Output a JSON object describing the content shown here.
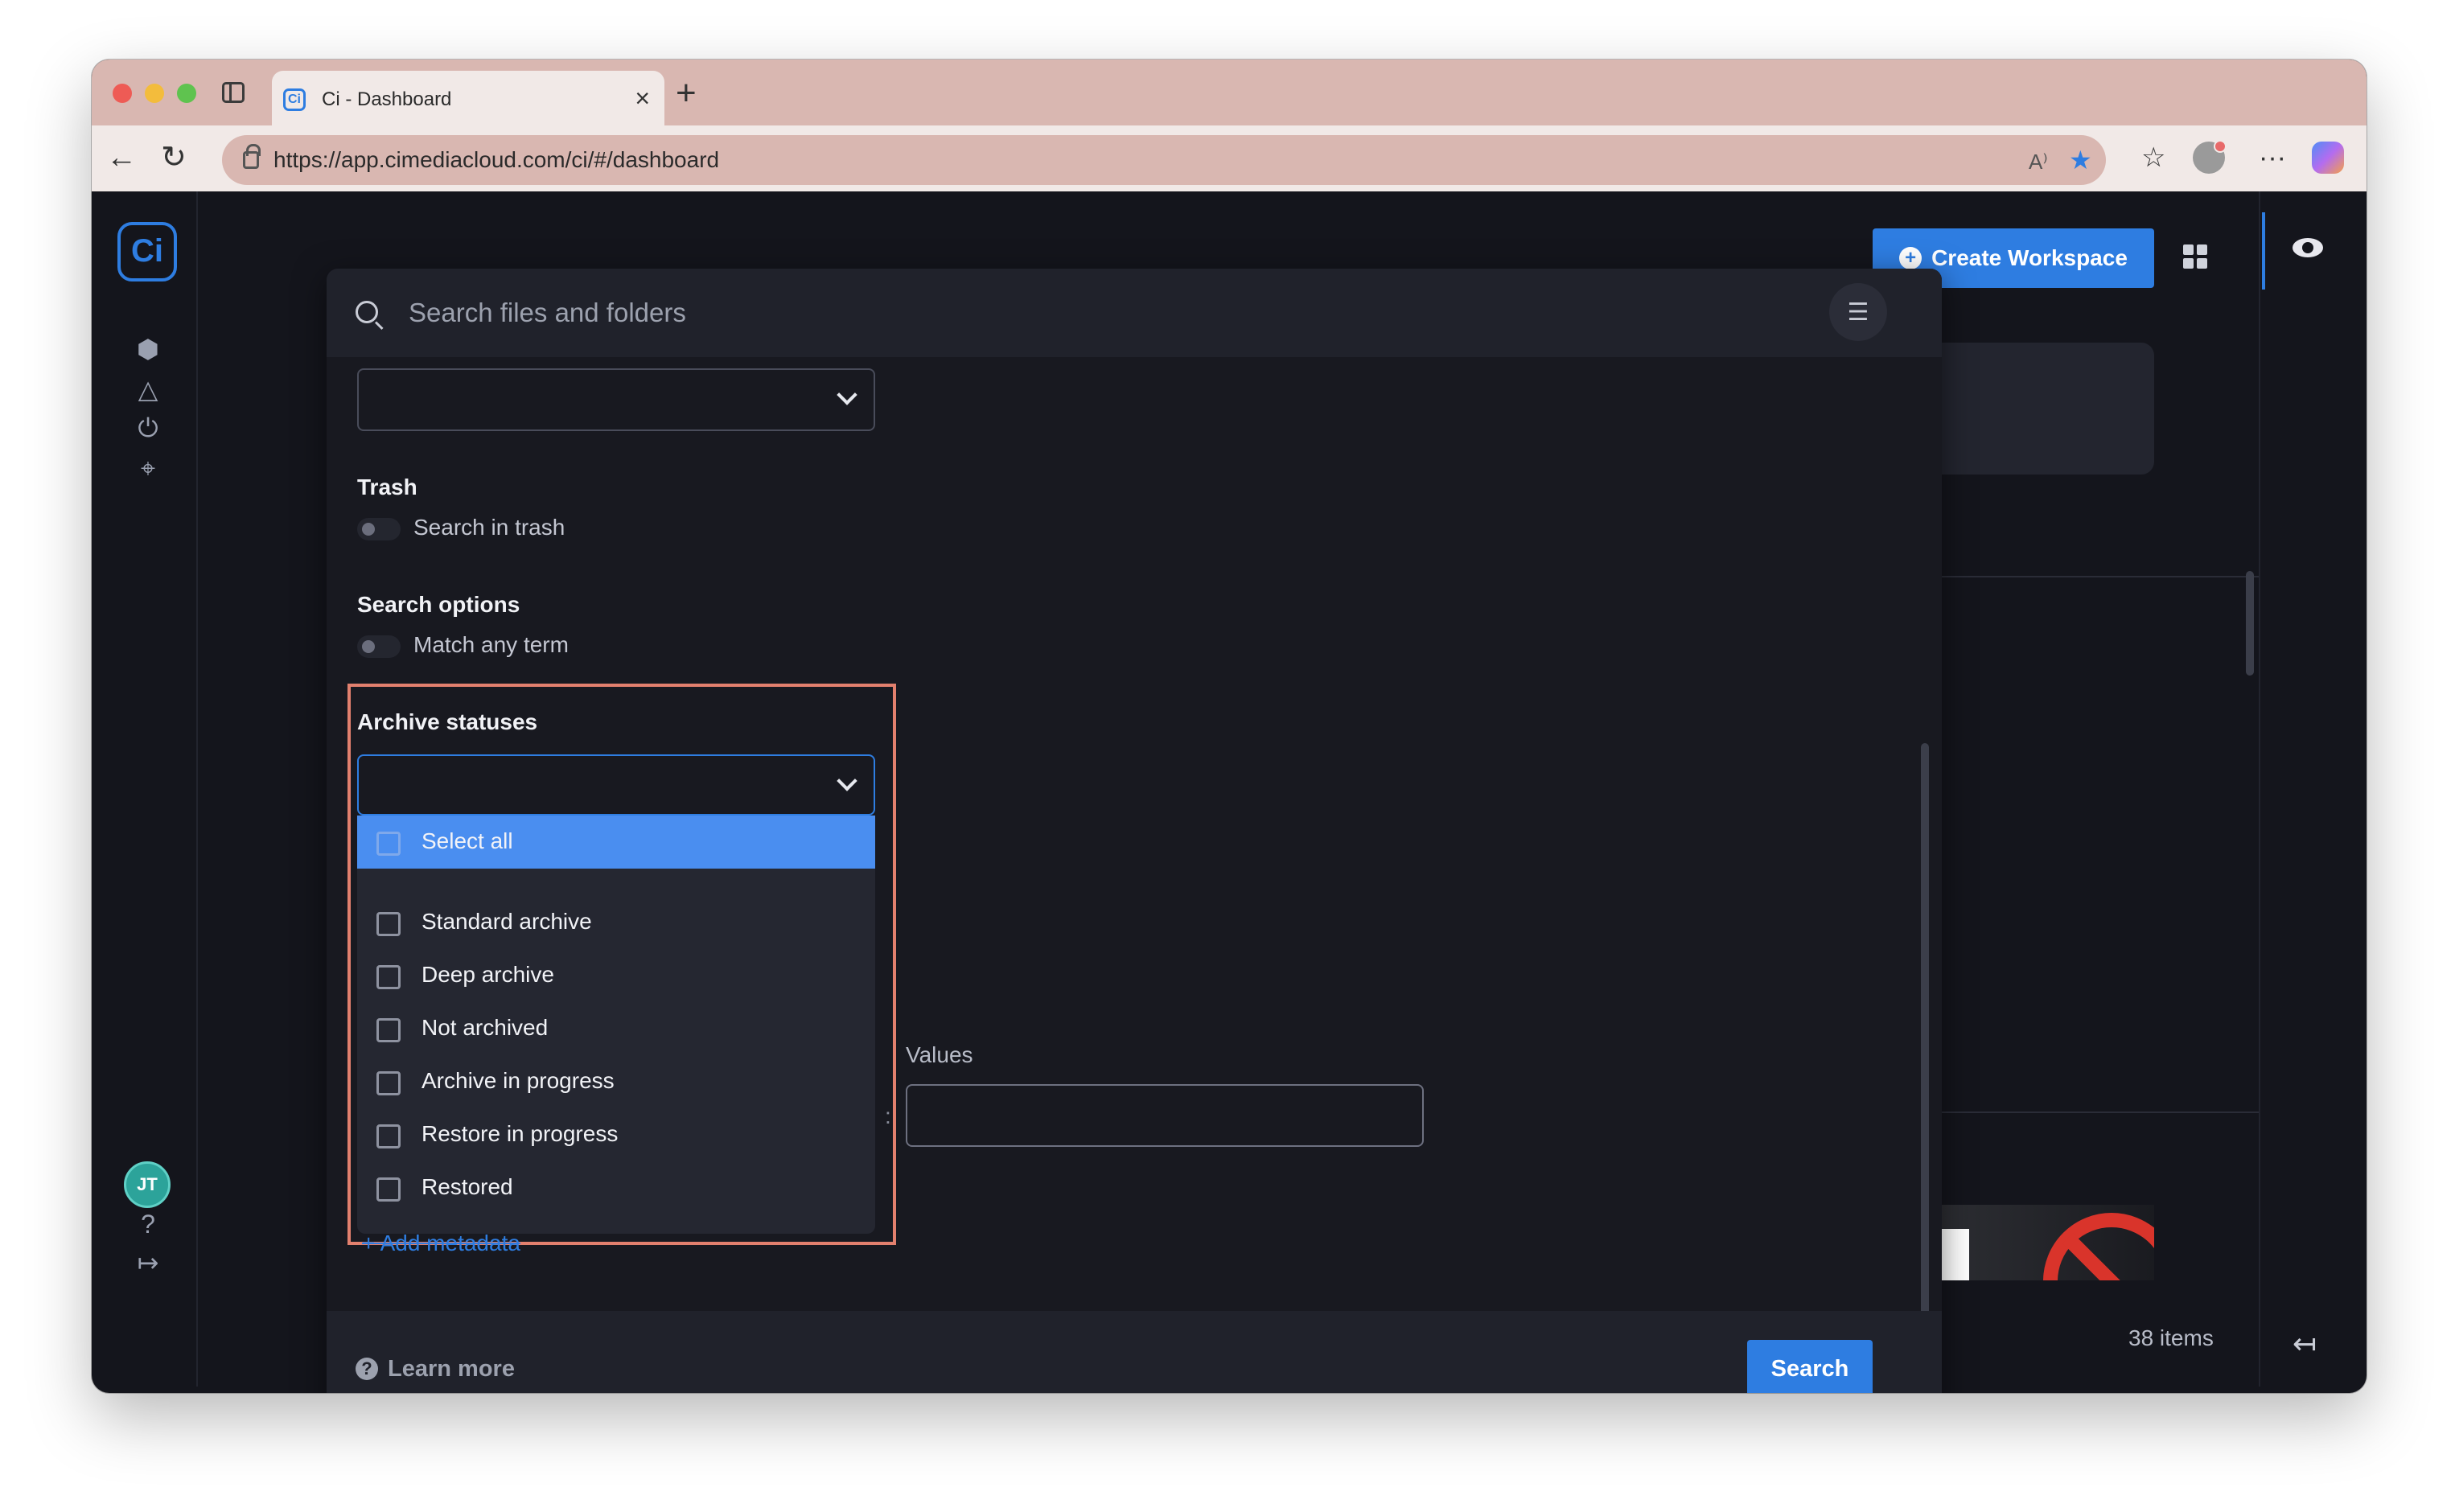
{
  "browser": {
    "tab_title": "Ci - Dashboard",
    "tab_favicon": "Ci",
    "url": "https://app.cimediacloud.com/ci/#/dashboard",
    "icons": [
      "back-arrow-icon",
      "reload-icon",
      "lock-icon",
      "read-aloud-icon",
      "star-icon",
      "favorites-icon",
      "profile-icon",
      "more-icon",
      "copilot-icon"
    ]
  },
  "rail": {
    "logo": "Ci",
    "items": [
      "cube-icon",
      "cloud-icon",
      "power-icon",
      "target-icon"
    ],
    "avatar_initials": "JT",
    "help_icon": "question-icon",
    "signout_icon": "signout-icon"
  },
  "header": {
    "create_workspace_label": "Create Workspace"
  },
  "footer": {
    "items_count": "38 items"
  },
  "search": {
    "placeholder": "Search files and folders",
    "trash": {
      "title": "Trash",
      "toggle_label": "Search in trash"
    },
    "options": {
      "title": "Search options",
      "toggle_label": "Match any term"
    },
    "archive": {
      "title": "Archive statuses",
      "select_all": "Select all",
      "items": [
        "Standard archive",
        "Deep archive",
        "Not archived",
        "Archive in progress",
        "Restore in progress",
        "Restored"
      ]
    },
    "add_metadata": "+ Add metadata",
    "values_label": "Values",
    "learn_more": "Learn more",
    "search_button": "Search"
  },
  "colors": {
    "accent": "#2e7de1",
    "highlight": "#e2806e",
    "panel": "#181920"
  }
}
